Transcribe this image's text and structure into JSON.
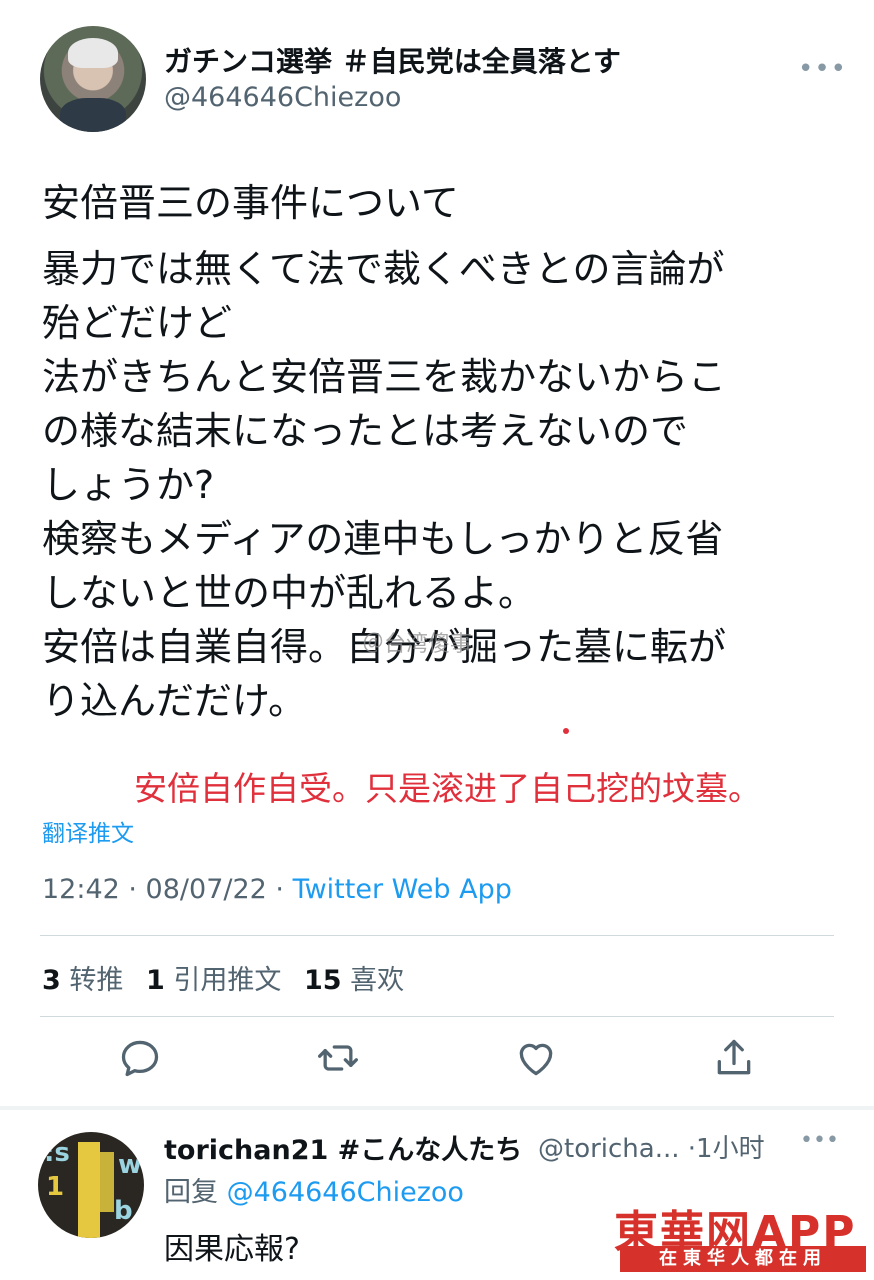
{
  "tweet": {
    "author_name": "ガチンコ選挙 ＃自民党は全員落とす",
    "author_handle": "@464646Chiezoo",
    "more_icon": "more-icon",
    "body_first": "安倍晋三の事件について",
    "body_rest": "暴力では無くて法で裁くべきとの言論が\n殆どだけど\n法がきちんと安倍晋三を裁かないからこ\nの様な結末になったとは考えないので\nしょうか?\n検察もメディアの連中もしっかりと反省\nしないと世の中が乱れるよ。\n安倍は自業自得。自分が掘った墓に転が\nり込んだだけ。",
    "translation_note": "安倍自作自受。只是滚进了自己挖的坟墓。",
    "translate_link": "翻译推文",
    "time": "12:42 · 08/07/22 · ",
    "source_app": "Twitter Web App",
    "watermark": "＠台湾傻事"
  },
  "stats": {
    "retweets_count": "3",
    "retweets_label": "转推",
    "quotes_count": "1",
    "quotes_label": "引用推文",
    "likes_count": "15",
    "likes_label": "喜欢"
  },
  "actions": [
    "reply-icon",
    "retweet-icon",
    "like-icon",
    "share-icon"
  ],
  "reply": {
    "author_name": "torichan21 #こんな人たち",
    "author_handle": "@toricha... ·1小时",
    "reply_prefix": "回复 ",
    "reply_mention": "@464646Chiezoo",
    "text": "因果応報?"
  },
  "logo": {
    "main": "東華网APP",
    "sub": "在東华人都在用"
  },
  "colors": {
    "accent": "#1d9bf0",
    "text": "#0f1419",
    "secondary": "#536471",
    "note_red": "#e0303c",
    "logo_red": "#d6322b"
  }
}
